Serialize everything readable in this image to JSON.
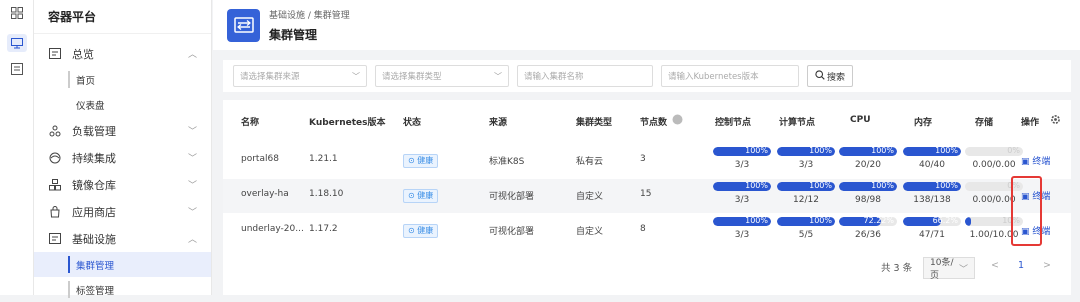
{
  "rail": {
    "icons": [
      "grid-icon",
      "monitor-icon",
      "list-icon"
    ]
  },
  "sidebar": {
    "title": "容器平台",
    "groups": [
      {
        "label": "总览",
        "chev": "^",
        "icon": "overview-icon"
      },
      {
        "label": "负载管理",
        "chev": "v",
        "icon": "workload-icon"
      },
      {
        "label": "持续集成",
        "chev": "v",
        "icon": "ci-icon"
      },
      {
        "label": "镜像仓库",
        "chev": "v",
        "icon": "registry-icon"
      },
      {
        "label": "应用商店",
        "chev": "v",
        "icon": "store-icon"
      },
      {
        "label": "基础设施",
        "chev": "^",
        "icon": "infra-icon"
      }
    ],
    "overview_items": [
      "首页",
      "仪表盘"
    ],
    "infra_items": [
      "集群管理",
      "标签管理"
    ]
  },
  "header": {
    "breadcrumb": "基础设施 / 集群管理",
    "title": "集群管理"
  },
  "filters": {
    "source_placeholder": "请选择集群来源",
    "type_placeholder": "请选择集群类型",
    "name_placeholder": "请输入集群名称",
    "version_placeholder": "请输入Kubernetes版本",
    "search_label": "搜索"
  },
  "table": {
    "headers": [
      "名称",
      "Kubernetes版本",
      "状态",
      "来源",
      "集群类型",
      "节点数",
      "控制节点",
      "计算节点",
      "CPU",
      "内存",
      "存储",
      "操作"
    ],
    "rows": [
      {
        "name": "portal68",
        "version": "1.21.1",
        "status": "健康",
        "source": "标准K8S",
        "type": "私有云",
        "nodes": "3",
        "control": {
          "pct": "100%",
          "frac": "3/3",
          "v": 1.0
        },
        "compute": {
          "pct": "100%",
          "frac": "3/3",
          "v": 1.0
        },
        "cpu": {
          "pct": "100%",
          "frac": "20/20",
          "v": 1.0
        },
        "mem": {
          "pct": "100%",
          "frac": "40/40",
          "v": 1.0
        },
        "storage": {
          "pct": "0%",
          "frac": "0.00/0.00",
          "v": 0.0
        },
        "action": "终端"
      },
      {
        "name": "overlay-ha",
        "version": "1.18.10",
        "status": "健康",
        "source": "可视化部署",
        "type": "自定义",
        "nodes": "15",
        "control": {
          "pct": "100%",
          "frac": "3/3",
          "v": 1.0
        },
        "compute": {
          "pct": "100%",
          "frac": "12/12",
          "v": 1.0
        },
        "cpu": {
          "pct": "100%",
          "frac": "98/98",
          "v": 1.0
        },
        "mem": {
          "pct": "100%",
          "frac": "138/138",
          "v": 1.0
        },
        "storage": {
          "pct": "0%",
          "frac": "0.00/0.00",
          "v": 0.0
        },
        "action": "终端"
      },
      {
        "name": "underlay-20...",
        "version": "1.17.2",
        "status": "健康",
        "source": "可视化部署",
        "type": "自定义",
        "nodes": "8",
        "control": {
          "pct": "100%",
          "frac": "3/3",
          "v": 1.0
        },
        "compute": {
          "pct": "100%",
          "frac": "5/5",
          "v": 1.0
        },
        "cpu": {
          "pct": "72.22%",
          "frac": "26/36",
          "v": 0.7222
        },
        "mem": {
          "pct": "66.2%",
          "frac": "47/71",
          "v": 0.662
        },
        "storage": {
          "pct": "10%",
          "frac": "1.00/10.00",
          "v": 0.1
        },
        "action": "终端"
      }
    ]
  },
  "pagination": {
    "total": "共 3 条",
    "page_size": "10条/页",
    "prev": "<",
    "current": "1",
    "next": ">"
  },
  "colors": {
    "accent": "#2a56d0",
    "highlight": "#e53935"
  }
}
